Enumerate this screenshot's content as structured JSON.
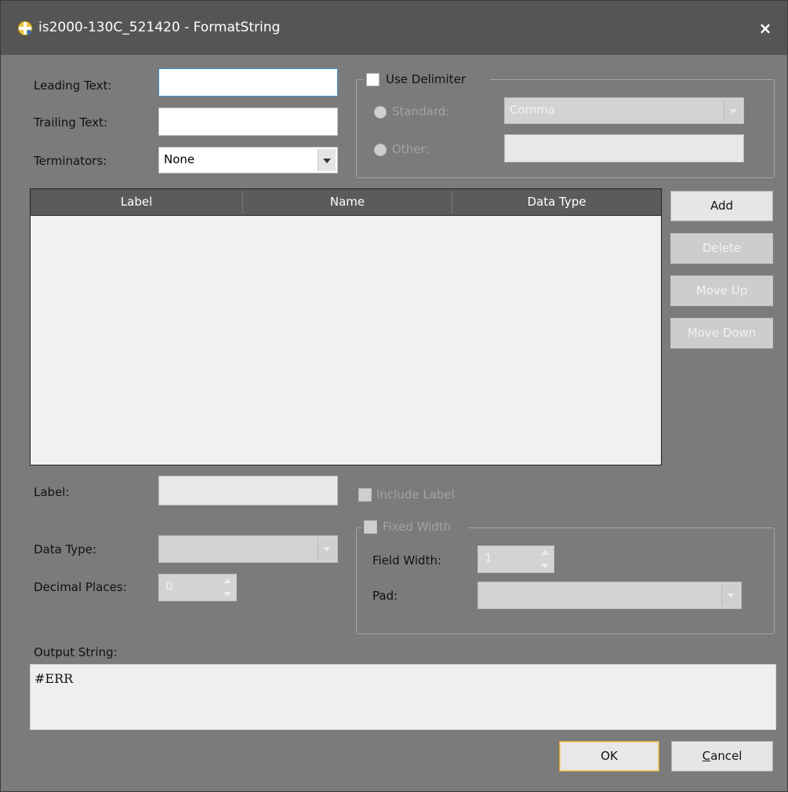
{
  "window": {
    "title": "is2000-130C_521420 - FormatString",
    "close_label": "×"
  },
  "form": {
    "leading_text_label": "Leading Text:",
    "leading_text_value": "",
    "trailing_text_label": "Trailing Text:",
    "trailing_text_value": "",
    "terminators_label": "Terminators:",
    "terminators_value": "None"
  },
  "delimiter": {
    "use_label": "Use Delimiter",
    "use_checked": false,
    "standard_label": "Standard:",
    "standard_value": "Comma",
    "other_label": "Other:",
    "other_value": ""
  },
  "table": {
    "columns": [
      "Label",
      "Name",
      "Data Type"
    ],
    "rows": []
  },
  "side_buttons": {
    "add": "Add",
    "delete": "Delete",
    "move_up": "Move Up",
    "move_down": "Move Down"
  },
  "field": {
    "label_label": "Label:",
    "label_value": "",
    "include_label": "Include Label",
    "data_type_label": "Data Type:",
    "data_type_value": "",
    "decimal_places_label": "Decimal Places:",
    "decimal_places_value": "0"
  },
  "fixed_width": {
    "label": "Fixed Width",
    "field_width_label": "Field Width:",
    "field_width_value": "1",
    "pad_label": "Pad:",
    "pad_value": ""
  },
  "output": {
    "label": "Output String:",
    "value": "#ERR"
  },
  "dialog_buttons": {
    "ok": "OK",
    "cancel": "Cancel"
  },
  "colors": {
    "background": "#7b7b7b",
    "titlebar": "#555555",
    "table_header": "#5b5b5b",
    "focus_border": "#3a8fd6",
    "ok_highlight": "#d9a845"
  }
}
